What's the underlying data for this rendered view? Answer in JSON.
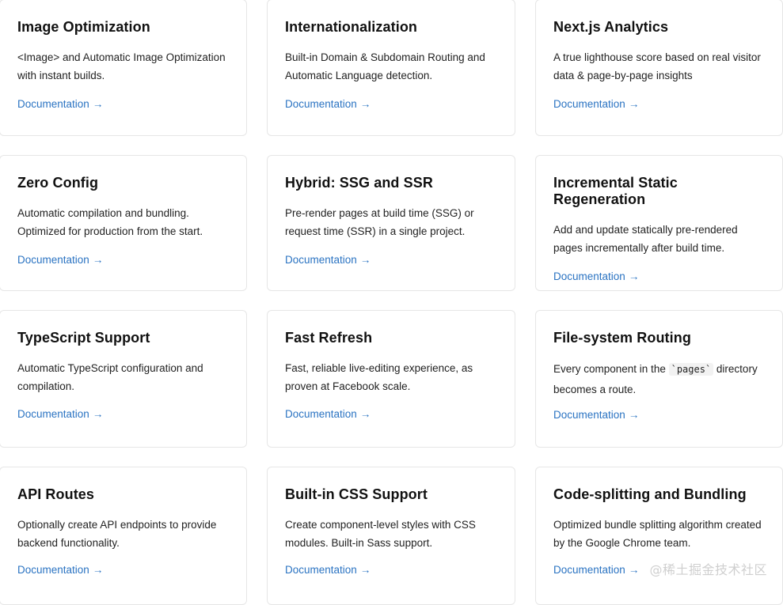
{
  "cards": [
    {
      "title": "Image Optimization",
      "desc": "<Image> and Automatic Image Optimization with instant builds.",
      "link": "Documentation"
    },
    {
      "title": "Internationalization",
      "desc": "Built-in Domain & Subdomain Routing and Automatic Language detection.",
      "link": "Documentation"
    },
    {
      "title": "Next.js Analytics",
      "desc": "A true lighthouse score based on real visitor data & page-by-page insights",
      "link": "Documentation"
    },
    {
      "title": "Zero Config",
      "desc": "Automatic compilation and bundling. Optimized for production from the start.",
      "link": "Documentation"
    },
    {
      "title": "Hybrid: SSG and SSR",
      "desc": "Pre-render pages at build time (SSG) or request time (SSR) in a single project.",
      "link": "Documentation"
    },
    {
      "title": "Incremental Static Regeneration",
      "desc": "Add and update statically pre-rendered pages incrementally after build time.",
      "link": "Documentation"
    },
    {
      "title": "TypeScript Support",
      "desc": "Automatic TypeScript configuration and compilation.",
      "link": "Documentation"
    },
    {
      "title": "Fast Refresh",
      "desc": "Fast, reliable live-editing experience, as proven at Facebook scale.",
      "link": "Documentation"
    },
    {
      "title": "File-system Routing",
      "desc_before": "Every component in the ",
      "desc_code": "`pages`",
      "desc_after": " directory becomes a route.",
      "link": "Documentation"
    },
    {
      "title": "API Routes",
      "desc": "Optionally create API endpoints to provide backend functionality.",
      "link": "Documentation"
    },
    {
      "title": "Built-in CSS Support",
      "desc": "Create component-level styles with CSS modules. Built-in Sass support.",
      "link": "Documentation"
    },
    {
      "title": "Code-splitting and Bundling",
      "desc": "Optimized bundle splitting algorithm created by the Google Chrome team.",
      "link": "Documentation"
    }
  ],
  "arrow_glyph": "→",
  "watermark": "@稀土掘金技术社区"
}
